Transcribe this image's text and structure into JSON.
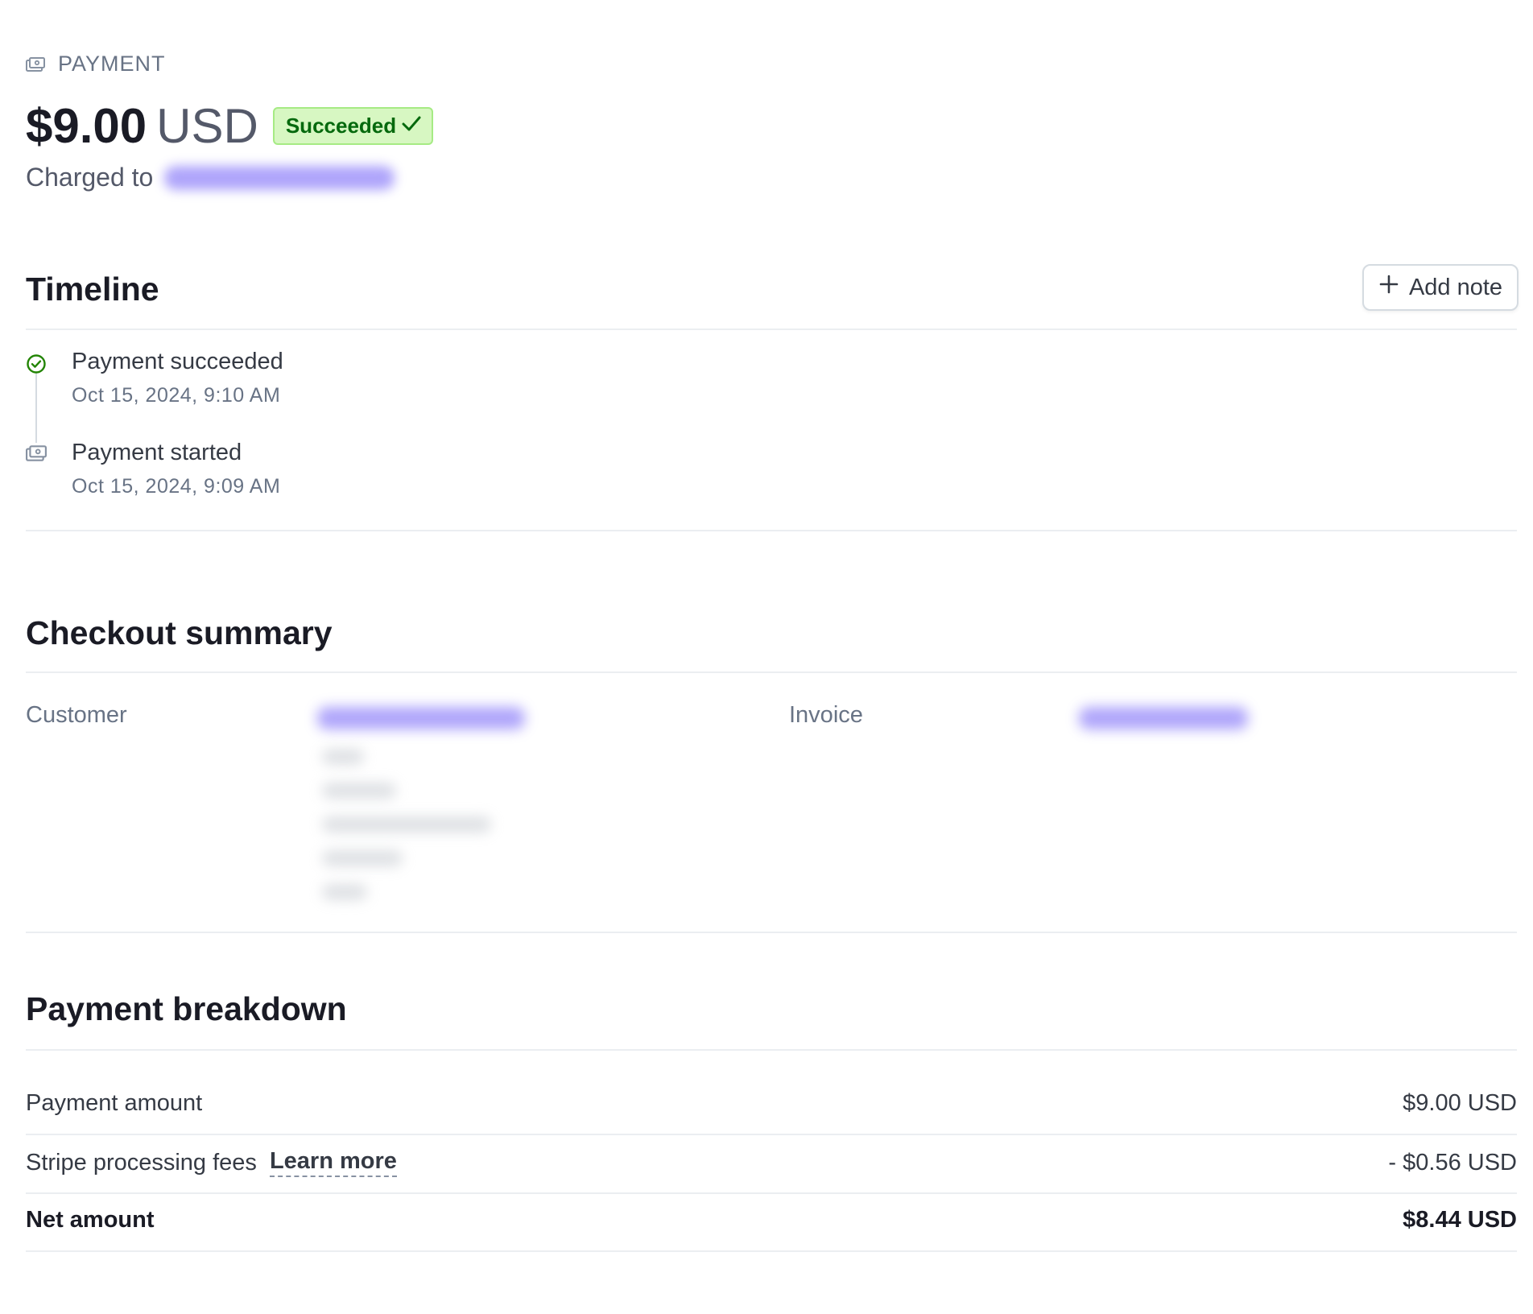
{
  "header": {
    "eyebrow": "PAYMENT",
    "amount": "$9.00",
    "currency": "USD",
    "status": "Succeeded",
    "charged_to_label": "Charged to"
  },
  "timeline": {
    "title": "Timeline",
    "add_note_label": "Add note",
    "events": [
      {
        "title": "Payment succeeded",
        "time": "Oct 15, 2024, 9:10 AM",
        "icon": "check-circle-icon"
      },
      {
        "title": "Payment started",
        "time": "Oct 15, 2024, 9:09 AM",
        "icon": "money-icon"
      }
    ]
  },
  "checkout_summary": {
    "title": "Checkout summary",
    "customer_label": "Customer",
    "invoice_label": "Invoice"
  },
  "breakdown": {
    "title": "Payment breakdown",
    "rows": [
      {
        "label": "Payment amount",
        "value": "$9.00 USD"
      },
      {
        "label": "Stripe processing fees",
        "link": "Learn more",
        "value": "- $0.56 USD"
      },
      {
        "label": "Net amount",
        "value": "$8.44 USD"
      }
    ]
  },
  "colors": {
    "success_bg": "#d7f7c2",
    "success_text": "#05690d",
    "link_blur": "#8d7ff9",
    "divider": "#ebeef1"
  }
}
